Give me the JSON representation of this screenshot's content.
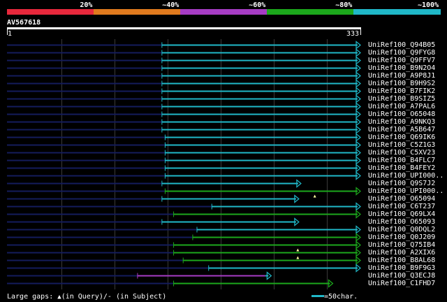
{
  "scale": {
    "labels": [
      "20%",
      "~40%",
      "~60%",
      "~80%",
      "~100%"
    ],
    "colors": [
      "#e8283c",
      "#e07a1e",
      "#a63cc4",
      "#1ca81c",
      "#20b8c8"
    ]
  },
  "query": {
    "name": "AV567618",
    "start": "1",
    "end": "333"
  },
  "hits": [
    {
      "name": "UniRef100_Q94B05",
      "color": "#20b8c8",
      "qstart": 146,
      "qend": 333,
      "arrow": true,
      "gap_mark": null
    },
    {
      "name": "UniRef100_Q9FYG8",
      "color": "#20b8c8",
      "qstart": 146,
      "qend": 333,
      "arrow": true,
      "gap_mark": null
    },
    {
      "name": "UniRef100_Q9FFV7",
      "color": "#20b8c8",
      "qstart": 146,
      "qend": 333,
      "arrow": true,
      "gap_mark": null
    },
    {
      "name": "UniRef100_B9N2O4",
      "color": "#20b8c8",
      "qstart": 146,
      "qend": 333,
      "arrow": true,
      "gap_mark": null
    },
    {
      "name": "UniRef100_A9P8J1",
      "color": "#20b8c8",
      "qstart": 146,
      "qend": 333,
      "arrow": true,
      "gap_mark": null
    },
    {
      "name": "UniRef100_B9H9S2",
      "color": "#20b8c8",
      "qstart": 146,
      "qend": 333,
      "arrow": true,
      "gap_mark": null
    },
    {
      "name": "UniRef100_B7FIK2",
      "color": "#20b8c8",
      "qstart": 146,
      "qend": 333,
      "arrow": true,
      "gap_mark": null
    },
    {
      "name": "UniRef100_B9SIZ5",
      "color": "#20b8c8",
      "qstart": 146,
      "qend": 333,
      "arrow": true,
      "gap_mark": null
    },
    {
      "name": "UniRef100_A7PAL6",
      "color": "#20b8c8",
      "qstart": 146,
      "qend": 333,
      "arrow": true,
      "gap_mark": null
    },
    {
      "name": "UniRef100_O65048",
      "color": "#20b8c8",
      "qstart": 146,
      "qend": 333,
      "arrow": true,
      "gap_mark": null
    },
    {
      "name": "UniRef100_A9NKQ3",
      "color": "#20b8c8",
      "qstart": 146,
      "qend": 333,
      "arrow": true,
      "gap_mark": null
    },
    {
      "name": "UniRef100_A5B647",
      "color": "#20b8c8",
      "qstart": 146,
      "qend": 333,
      "arrow": true,
      "gap_mark": null
    },
    {
      "name": "UniRef100_Q69IK6",
      "color": "#20b8c8",
      "qstart": 149,
      "qend": 333,
      "arrow": true,
      "gap_mark": null
    },
    {
      "name": "UniRef100_C5Z1G3",
      "color": "#20b8c8",
      "qstart": 149,
      "qend": 333,
      "arrow": true,
      "gap_mark": null
    },
    {
      "name": "UniRef100_C5XV23",
      "color": "#20b8c8",
      "qstart": 149,
      "qend": 333,
      "arrow": true,
      "gap_mark": null
    },
    {
      "name": "UniRef100_B4FLC7",
      "color": "#20b8c8",
      "qstart": 149,
      "qend": 333,
      "arrow": true,
      "gap_mark": null
    },
    {
      "name": "UniRef100_B4FEY2",
      "color": "#20b8c8",
      "qstart": 149,
      "qend": 333,
      "arrow": true,
      "gap_mark": null
    },
    {
      "name": "UniRef100_UPI000..",
      "color": "#20b8c8",
      "qstart": 149,
      "qend": 333,
      "arrow": true,
      "gap_mark": null
    },
    {
      "name": "UniRef100_Q9S7J2",
      "color": "#20b8c8",
      "qstart": 146,
      "qend": 277,
      "arrow": true,
      "gap_mark": null
    },
    {
      "name": "UniRef100_UPI000..",
      "color": "#1ca81c",
      "qstart": 149,
      "qend": 333,
      "arrow": true,
      "gap_mark": 290
    },
    {
      "name": "UniRef100_O65094",
      "color": "#20b8c8",
      "qstart": 146,
      "qend": 275,
      "arrow": true,
      "gap_mark": null
    },
    {
      "name": "UniRef100_C6T237",
      "color": "#20b8c8",
      "qstart": 193,
      "qend": 333,
      "arrow": true,
      "gap_mark": null
    },
    {
      "name": "UniRef100_Q69LX4",
      "color": "#1ca81c",
      "qstart": 157,
      "qend": 333,
      "arrow": true,
      "gap_mark": null
    },
    {
      "name": "UniRef100_O65093",
      "color": "#20b8c8",
      "qstart": 146,
      "qend": 275,
      "arrow": true,
      "gap_mark": null
    },
    {
      "name": "UniRef100_Q0DQL2",
      "color": "#20b8c8",
      "qstart": 179,
      "qend": 333,
      "arrow": true,
      "gap_mark": null
    },
    {
      "name": "UniRef100_Q0J209",
      "color": "#1ca81c",
      "qstart": 175,
      "qend": 333,
      "arrow": true,
      "gap_mark": null
    },
    {
      "name": "UniRef100_Q75IB4",
      "color": "#1ca81c",
      "qstart": 157,
      "qend": 333,
      "arrow": true,
      "gap_mark": 274
    },
    {
      "name": "UniRef100_A2XIX6",
      "color": "#1ca81c",
      "qstart": 157,
      "qend": 333,
      "arrow": true,
      "gap_mark": 274
    },
    {
      "name": "UniRef100_B8AL68",
      "color": "#1ca81c",
      "qstart": 166,
      "qend": 333,
      "arrow": true,
      "gap_mark": null
    },
    {
      "name": "UniRef100_B9F9G3",
      "color": "#20b8c8",
      "qstart": 190,
      "qend": 333,
      "arrow": true,
      "gap_mark": null
    },
    {
      "name": "UniRef100_Q3ECJ8",
      "color": "#a63cc4",
      "qstart": 123,
      "qend": 246,
      "arrow": true,
      "gap_mark": null,
      "tail_color": "#20b8c8",
      "tail_end": 249
    },
    {
      "name": "UniRef100_C1FHD7",
      "color": "#1ca81c",
      "qstart": 157,
      "qend": 307,
      "arrow": true,
      "gap_mark": null
    }
  ],
  "footer": {
    "gaps_text": "Large gaps:",
    "gap_query": "(in Query)/",
    "gap_subject": "- (in Subject)",
    "scale_text": "=50char."
  }
}
